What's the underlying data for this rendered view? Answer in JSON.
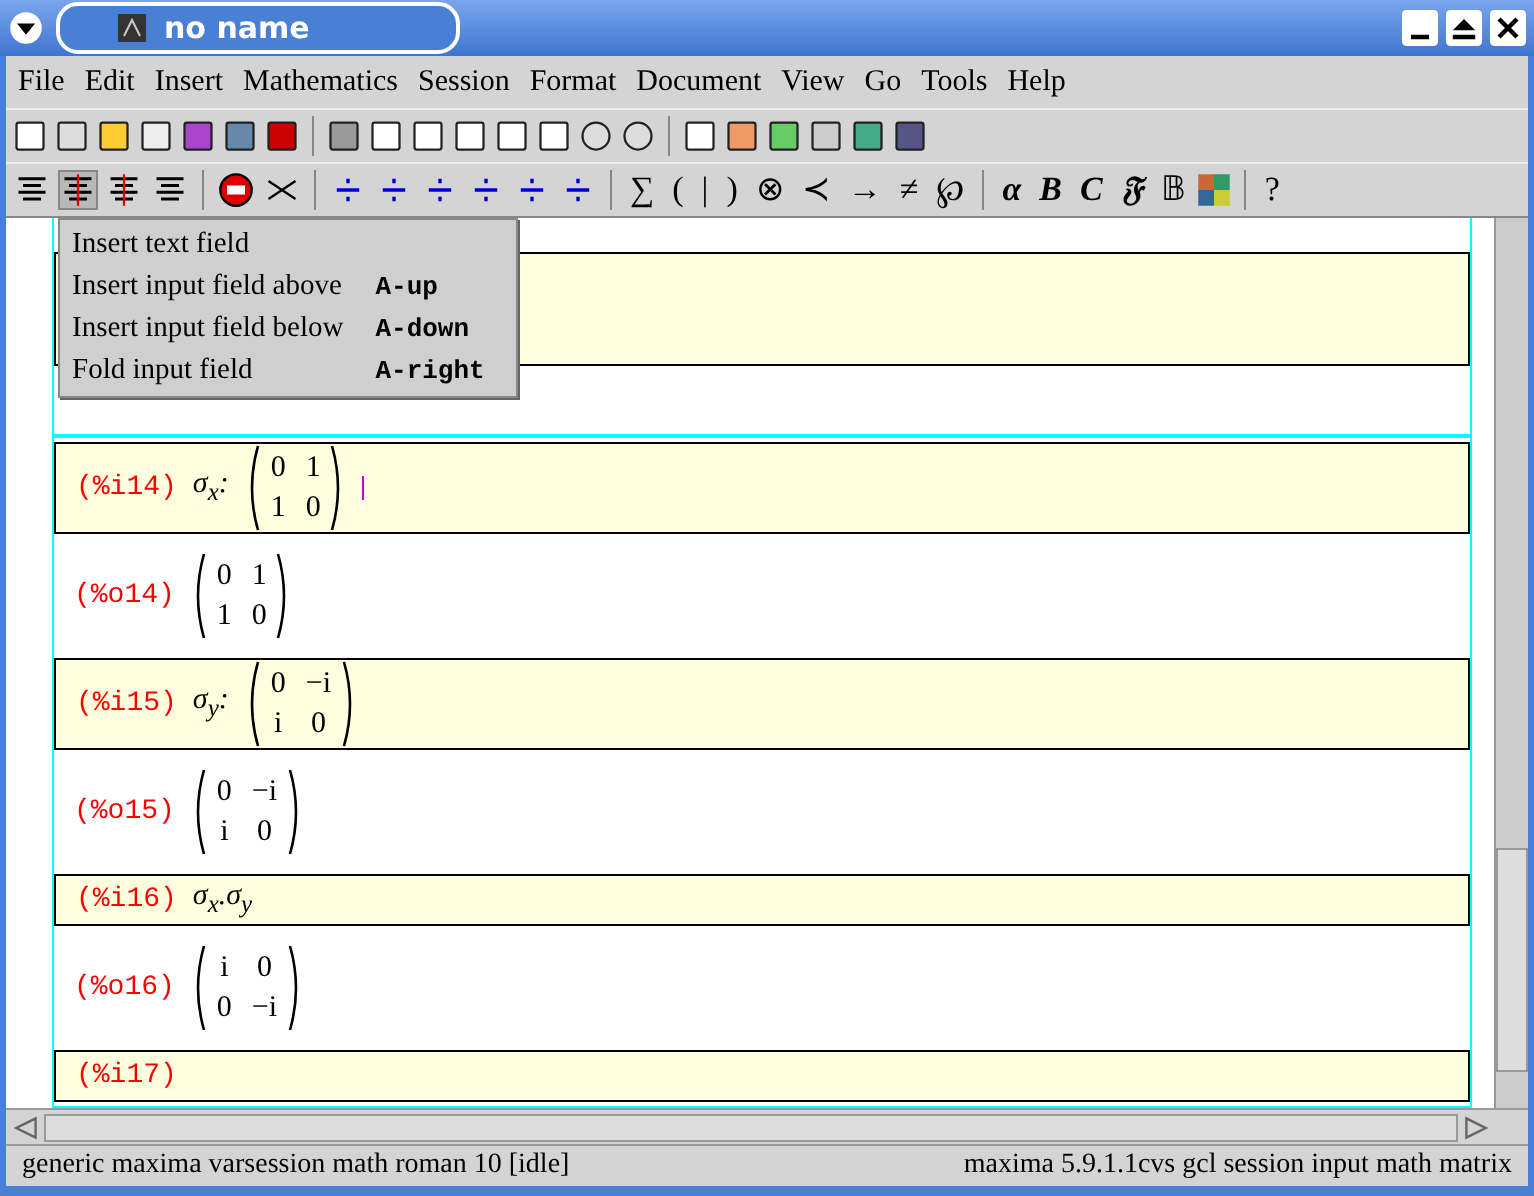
{
  "window": {
    "title": "no name"
  },
  "menubar": [
    "File",
    "Edit",
    "Insert",
    "Mathematics",
    "Session",
    "Format",
    "Document",
    "View",
    "Go",
    "Tools",
    "Help"
  ],
  "toolbar_glyphs": [
    "∑",
    "(",
    "|",
    ")",
    "⊗",
    "≺",
    "→",
    "≠",
    "℘",
    "α",
    "B",
    "C",
    "𝔉",
    "𝔹",
    "?"
  ],
  "popup_menu": [
    {
      "label": "Insert text field"
    },
    {
      "label": "Insert input field above",
      "shortcut": "A-up"
    },
    {
      "label": "Insert input field below",
      "shortcut": "A-down"
    },
    {
      "label": "Fold input field",
      "shortcut": "A-right"
    }
  ],
  "cells": [
    {
      "kind": "input"
    },
    {
      "kind": "output"
    },
    {
      "kind": "input",
      "label": "(%i14)",
      "prefix": "σ$_{x}$:",
      "matrix": [
        [
          "0",
          "1"
        ],
        [
          "1",
          "0"
        ]
      ]
    },
    {
      "kind": "output",
      "label": "(%o14)",
      "matrix": [
        [
          "0",
          "1"
        ],
        [
          "1",
          "0"
        ]
      ]
    },
    {
      "kind": "input",
      "label": "(%i15)",
      "prefix": "σ$_{y}$:",
      "matrix": [
        [
          "0",
          "−i"
        ],
        [
          "i",
          "0"
        ]
      ]
    },
    {
      "kind": "output",
      "label": "(%o15)",
      "matrix": [
        [
          "0",
          "−i"
        ],
        [
          "i",
          "0"
        ]
      ]
    },
    {
      "kind": "input",
      "label": "(%i16)",
      "prefix": "σ$_{x}$.σ$_{y}$"
    },
    {
      "kind": "output",
      "label": "(%o16)",
      "matrix": [
        [
          "i",
          "0"
        ],
        [
          "0",
          "−i"
        ]
      ]
    },
    {
      "kind": "input",
      "label": "(%i17)"
    }
  ],
  "status_bar": {
    "left": "generic maxima varsession math roman 10 [idle]",
    "right": "maxima 5.9.1.1cvs gcl session input math matrix"
  }
}
